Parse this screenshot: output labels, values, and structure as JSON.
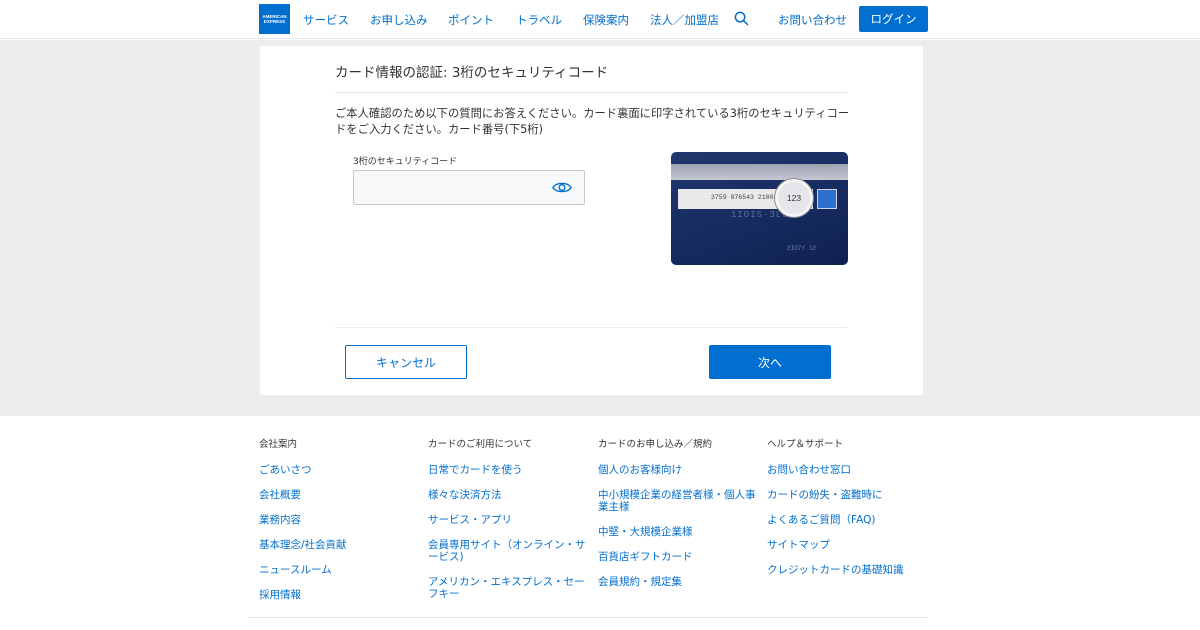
{
  "header": {
    "logo_line1": "AMERICAN",
    "logo_line2": "EXPRESS",
    "nav": [
      {
        "label": "サービス"
      },
      {
        "label": "お申し込み"
      },
      {
        "label": "ポイント"
      },
      {
        "label": "トラベル"
      },
      {
        "label": "保険案内"
      },
      {
        "label": "法人／加盟店"
      }
    ],
    "contact_label": "お問い合わせ",
    "login_label": "ログイン"
  },
  "verification": {
    "title": "カード情報の認証: 3桁のセキュリティコード",
    "description": "ご本人確認のため以下の質問にお答えください。カード裏面に印字されている3桁のセキュリティコードをご入力ください。カード番号(下5桁)",
    "field_label": "3桁のセキュリティコード",
    "field_value": "",
    "card_number_text": "3759 876543 21002",
    "card_code": "123",
    "cancel_label": "キャンセル",
    "next_label": "次へ"
  },
  "footer": {
    "columns": [
      {
        "heading": "会社案内",
        "links": [
          "ごあいさつ",
          "会社概要",
          "業務内容",
          "基本理念/社会貢献",
          "ニュースルーム",
          "採用情報"
        ]
      },
      {
        "heading": "カードのご利用について",
        "links": [
          "日常でカードを使う",
          "様々な決済方法",
          "サービス・アプリ",
          "会員専用サイト（オンライン・サービス)",
          "アメリカン・エキスプレス・セーフキー"
        ]
      },
      {
        "heading": "カードのお申し込み／規約",
        "links": [
          "個人のお客様向け",
          "中小規模企業の経営者様・個人事業主様",
          "中堅・大規模企業様",
          "百貨店ギフトカード",
          "会員規約・規定集"
        ]
      },
      {
        "heading": "ヘルプ＆サポート",
        "links": [
          "お問い合わせ窓口",
          "カードの紛失・盗難時に",
          "よくあるご質問（FAQ)",
          "サイトマップ",
          "クレジットカードの基礎知識"
        ]
      }
    ]
  },
  "colors": {
    "brand_blue": "#006fcf",
    "page_gray": "#ececec",
    "card_navy": "#152a5e"
  }
}
